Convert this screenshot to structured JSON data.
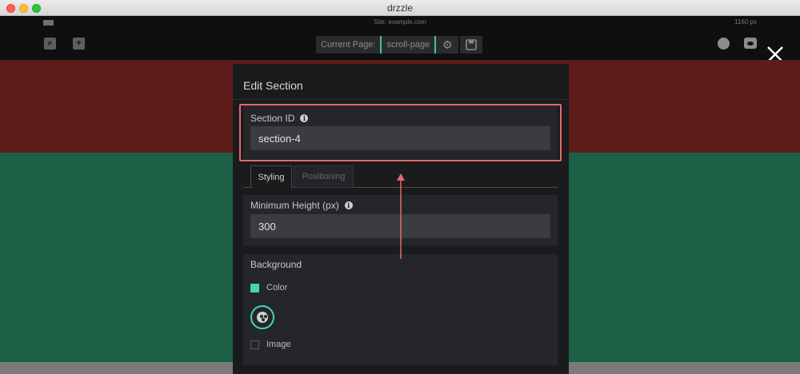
{
  "window": {
    "title": "drzzle"
  },
  "toolbar": {
    "site_label": "Site: example.com",
    "width_label": "1160 px",
    "current_page_label": "Current Page:",
    "current_page_value": "scroll-page",
    "icons": [
      "briefcase-icon",
      "search-page-icon",
      "add-page-icon",
      "gear-icon",
      "save-icon",
      "globe-icon",
      "preview-icon",
      "close-icon"
    ]
  },
  "panel": {
    "title": "Edit Section",
    "section_id": {
      "label": "Section ID",
      "value": "section-4"
    },
    "tabs": [
      {
        "label": "Styling",
        "active": true
      },
      {
        "label": "Positioning",
        "active": false
      }
    ],
    "min_height": {
      "label": "Minimum Height (px)",
      "value": "300"
    },
    "background": {
      "label": "Background",
      "color_option": {
        "label": "Color",
        "checked": true
      },
      "image_option": {
        "label": "Image",
        "checked": false
      }
    }
  },
  "colors": {
    "accent": "#3fd8b8",
    "section_red": "#5e1c1a",
    "section_green": "#1b6145",
    "highlight": "#e66a6a",
    "panel_bg": "#1a1b1d"
  }
}
